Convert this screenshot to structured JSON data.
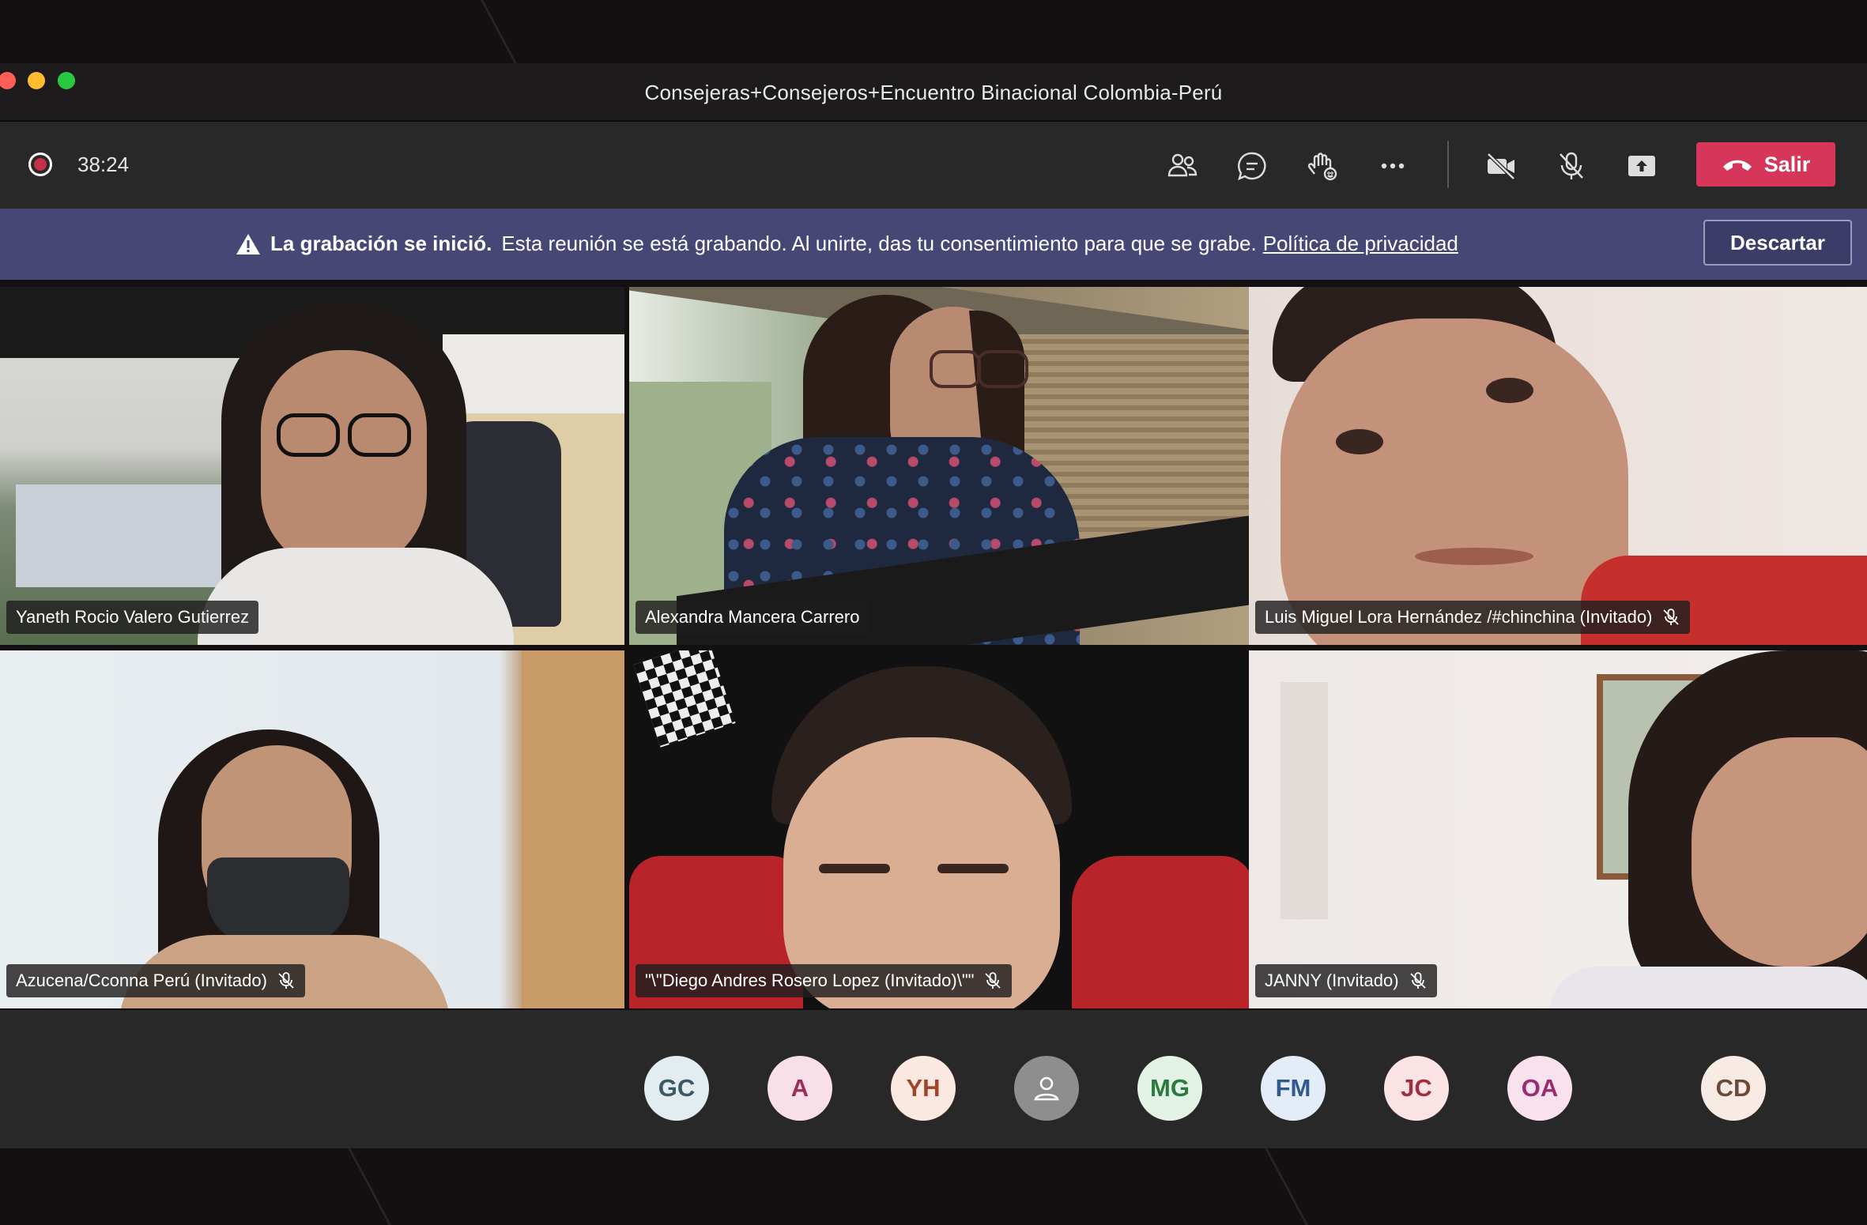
{
  "window": {
    "title": "Consejeras+Consejeros+Encuentro Binacional Colombia-Perú",
    "traffic_colors": [
      "#ff5f57",
      "#febc2e",
      "#28c840"
    ]
  },
  "toolbar": {
    "recording_indicator": "record-icon",
    "timer": "38:24",
    "buttons": [
      "people-icon",
      "chat-icon",
      "raise-hand-icon",
      "more-options-icon",
      "camera-off-icon",
      "mic-off-icon",
      "share-screen-icon"
    ],
    "leave_label": "Salir",
    "leave_color": "#d6365a"
  },
  "banner": {
    "bold": "La grabación se inició.",
    "text": "Esta reunión se está grabando. Al unirte, das tu consentimiento para que se grabe.",
    "link": "Política de privacidad",
    "dismiss_label": "Descartar",
    "background": "#464775"
  },
  "participants": [
    {
      "name": "Yaneth Rocio Valero Gutierrez",
      "muted": false
    },
    {
      "name": "Alexandra Mancera Carrero",
      "muted": false
    },
    {
      "name": "Luis Miguel Lora Hernández /#chinchina (Invitado)",
      "muted": true
    },
    {
      "name": "Azucena/Cconna Perú (Invitado)",
      "muted": true
    },
    {
      "name": "\"\\\"Diego Andres Rosero Lopez (Invitado)\\\"\"",
      "muted": true
    },
    {
      "name": "JANNY (Invitado)",
      "muted": true
    }
  ],
  "avatars": [
    {
      "initials": "GC",
      "bg": "#e3ecef",
      "fg": "#3b5a66"
    },
    {
      "initials": "A",
      "bg": "#f9dfe7",
      "fg": "#9c2c5a"
    },
    {
      "initials": "YH",
      "bg": "#fbe8e1",
      "fg": "#a0452c"
    },
    {
      "initials": "",
      "bg": "#8e8e8e",
      "fg": "#ffffff",
      "icon": "person-icon"
    },
    {
      "initials": "MG",
      "bg": "#e2f3e6",
      "fg": "#2b7a3f"
    },
    {
      "initials": "FM",
      "bg": "#e3ecf7",
      "fg": "#2f5a8e"
    },
    {
      "initials": "JC",
      "bg": "#fbe3e6",
      "fg": "#a12e3e"
    },
    {
      "initials": "OA",
      "bg": "#f9e1ee",
      "fg": "#9a2d6e"
    },
    {
      "initials": "CD",
      "bg": "#f7ebe4",
      "fg": "#6b4a3a"
    }
  ]
}
